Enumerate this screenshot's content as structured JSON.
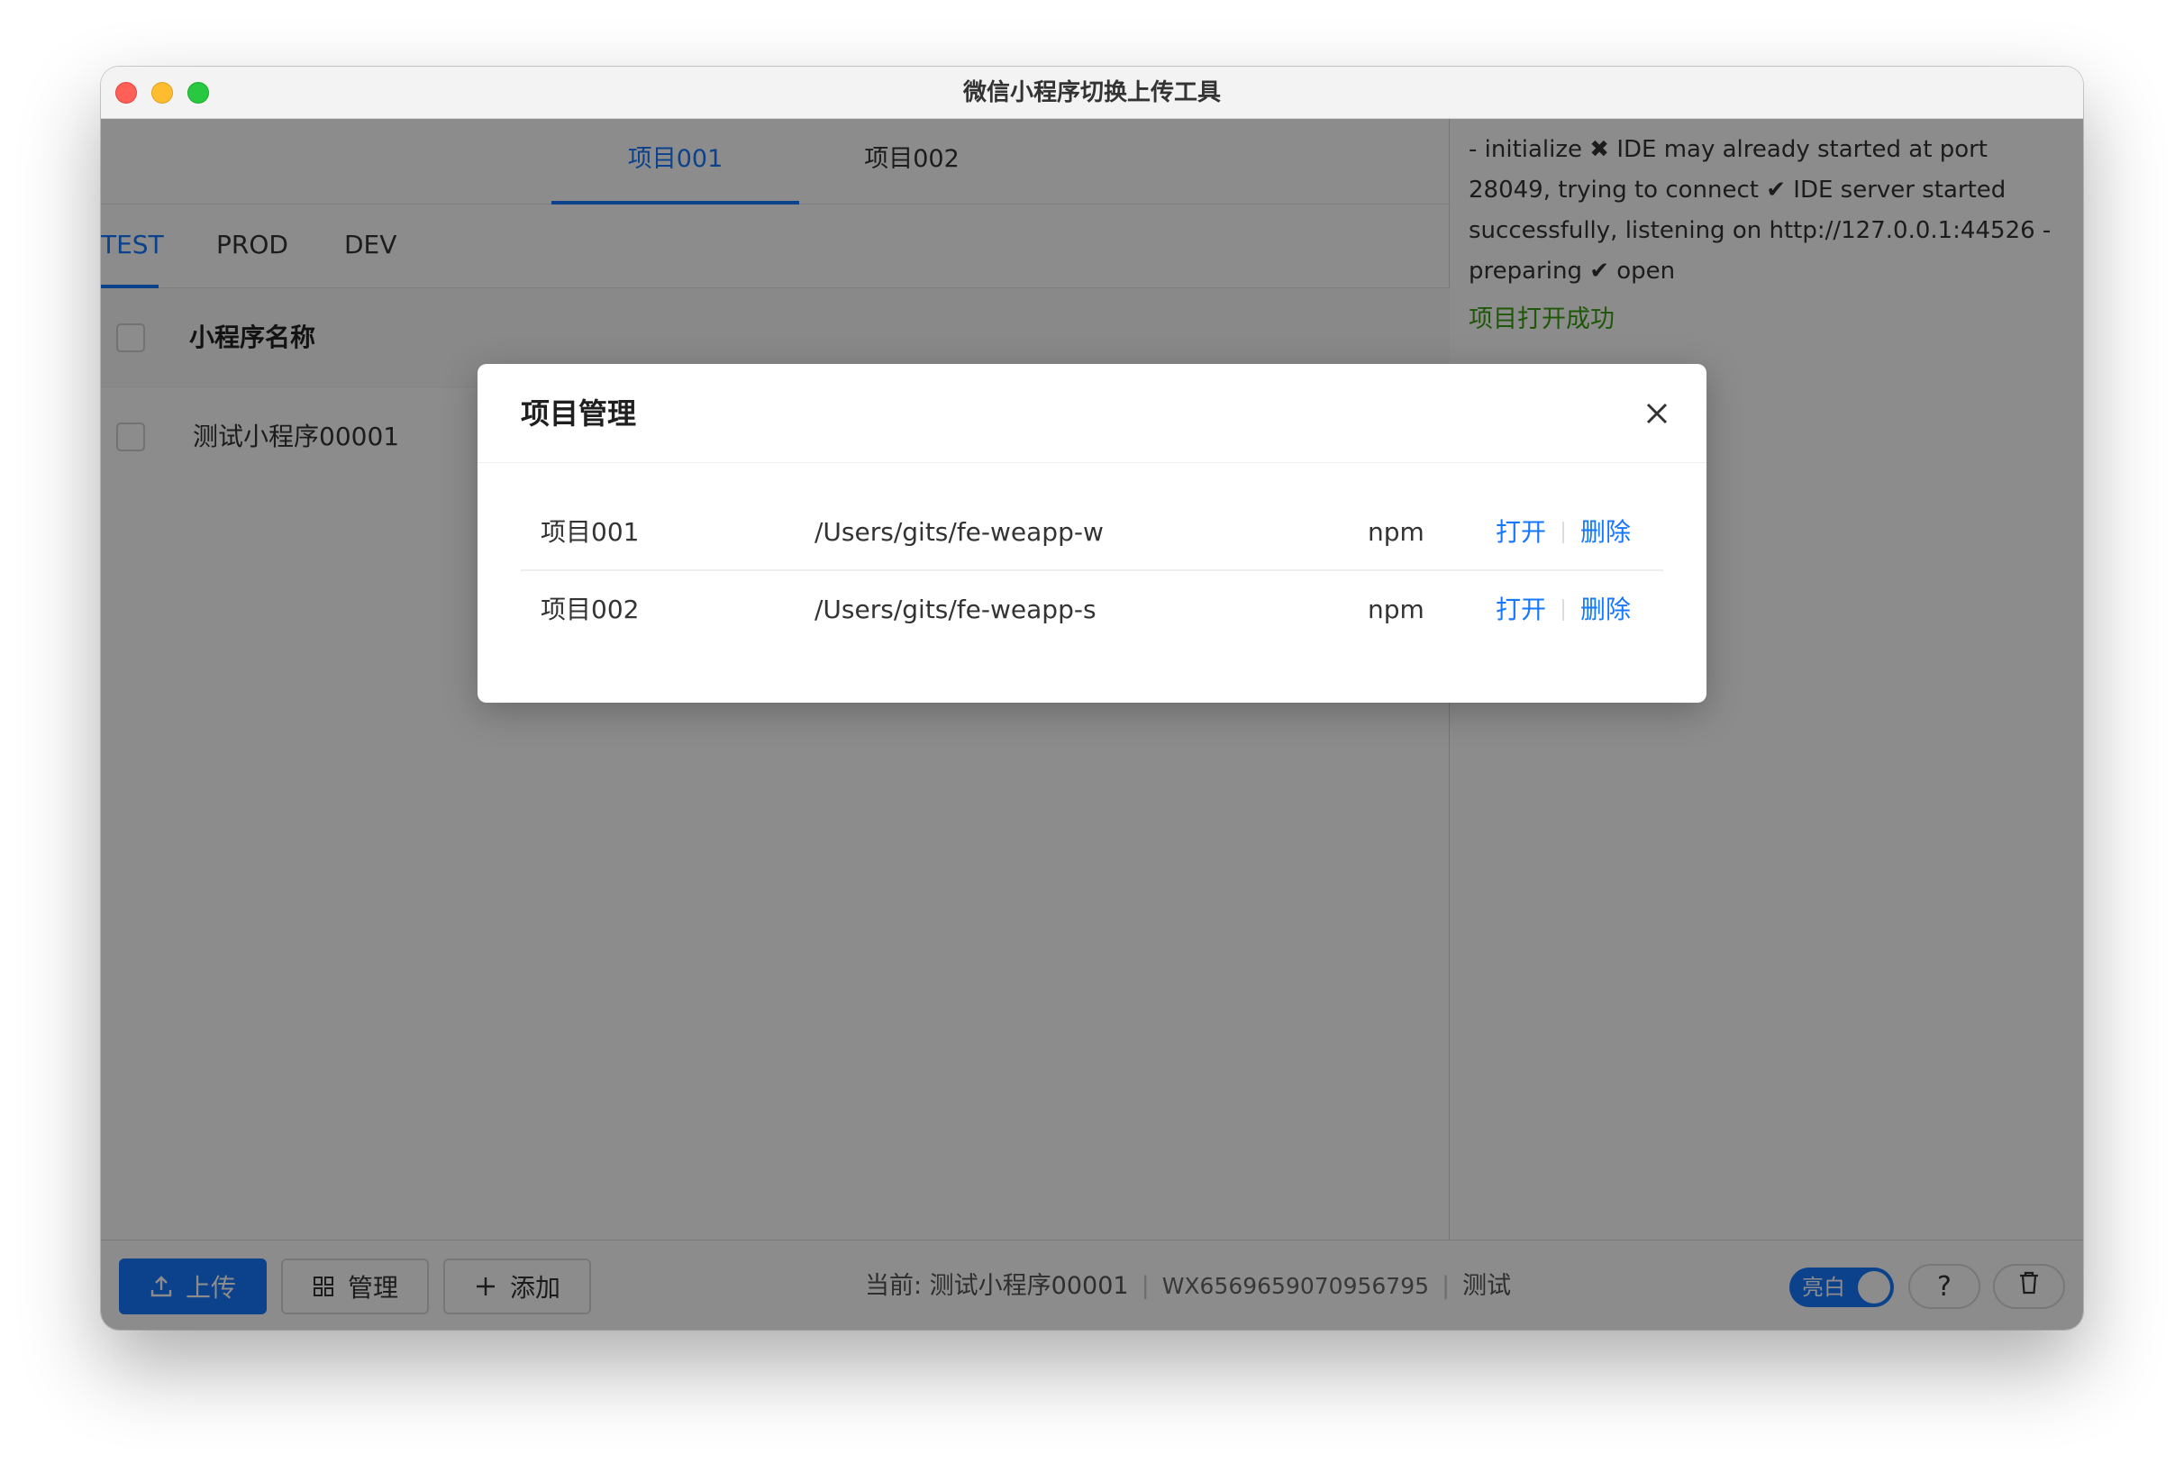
{
  "window": {
    "title": "微信小程序切换上传工具"
  },
  "project_tabs": [
    {
      "label": "项目001",
      "active": true
    },
    {
      "label": "项目002",
      "active": false
    }
  ],
  "env_tabs": [
    {
      "label": "TEST",
      "active": true
    },
    {
      "label": "PROD",
      "active": false
    },
    {
      "label": "DEV",
      "active": false
    }
  ],
  "table": {
    "header": "小程序名称",
    "rows": [
      {
        "name": "测试小程序00001"
      }
    ]
  },
  "log": {
    "text": "- initialize ✖ IDE may already started at port 28049, trying to connect ✔ IDE server started successfully, listening on http://127.0.0.1:44526 - preparing ✔ open",
    "success": "项目打开成功"
  },
  "toolbar": {
    "upload_label": "上传",
    "manage_label": "管理",
    "add_label": "添加",
    "status_current": "当前: 测试小程序00001",
    "status_appid": "WX6569659070956795",
    "status_env": "测试",
    "theme_label": "亮白",
    "help_label": "?"
  },
  "modal": {
    "title": "项目管理",
    "rows": [
      {
        "name": "项目001",
        "path": "/Users/gits/fe-weapp-w",
        "pm": "npm",
        "open": "打开",
        "delete": "删除"
      },
      {
        "name": "项目002",
        "path": "/Users/gits/fe-weapp-s",
        "pm": "npm",
        "open": "打开",
        "delete": "删除"
      }
    ]
  },
  "colors": {
    "primary": "#1677ff",
    "success": "#389e0d"
  },
  "icons": {
    "upload": "upload-icon",
    "manage": "grid-icon",
    "add": "plus-icon",
    "close": "close-icon",
    "trash": "trash-icon"
  }
}
